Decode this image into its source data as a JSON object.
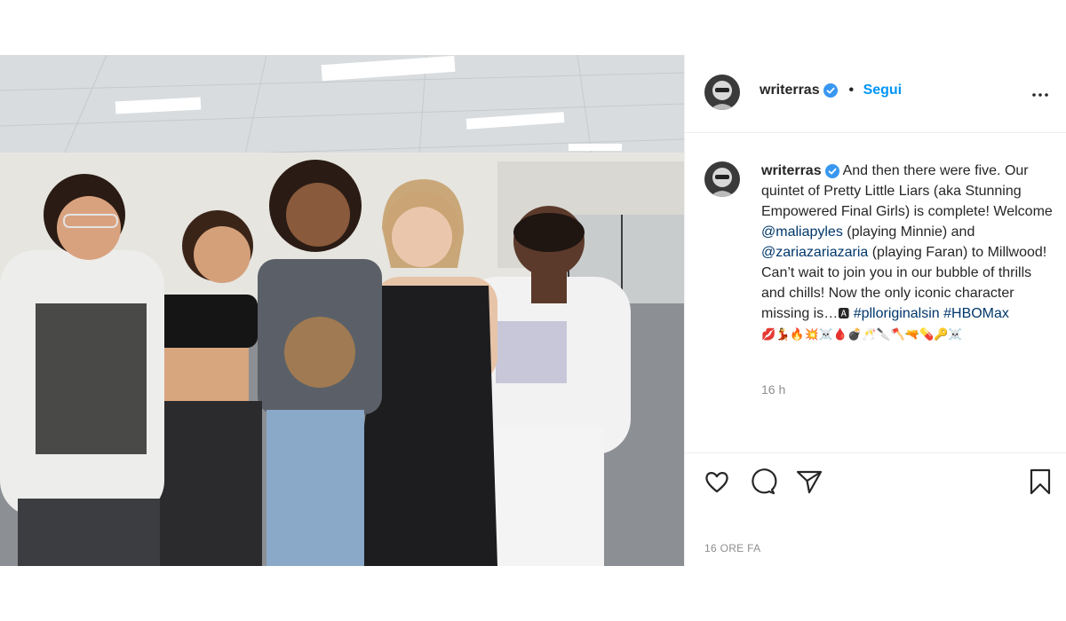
{
  "post": {
    "username": "writerras",
    "follow_label": "Segui",
    "separator": "•",
    "caption_parts": {
      "intro": "And then there were five. Our quintet of Pretty Little Liars (aka Stunning Empowered Final Girls) is complete! Welcome ",
      "mention1": "@maliapyles",
      "mid1": " (playing Minnie) and ",
      "mention2": "@zariazariazaria",
      "mid2": " (playing Faran) to Millwood! Can’t wait to join you in our bubble of thrills and chills! Now the only iconic character missing is…",
      "a_badge": "🅰",
      "hashtag1": "#plloriginalsin",
      "hashtag2": "#HBOMax",
      "emoji_line": "💋💃🔥💥☠️🩸💣🥂🔪🪓🔫💊🔑☠️"
    },
    "comment_time": "16 h",
    "posted_ago": "16 ORE FA"
  },
  "icons": {
    "verified": "verified-badge-icon",
    "more": "more-options-icon",
    "like": "heart-icon",
    "comment": "comment-bubble-icon",
    "share": "paper-plane-icon",
    "save": "bookmark-icon"
  },
  "colors": {
    "accent": "#0095f6",
    "link": "#00376b",
    "text": "#262626",
    "muted": "#8e8e8e",
    "border": "#efefef"
  }
}
